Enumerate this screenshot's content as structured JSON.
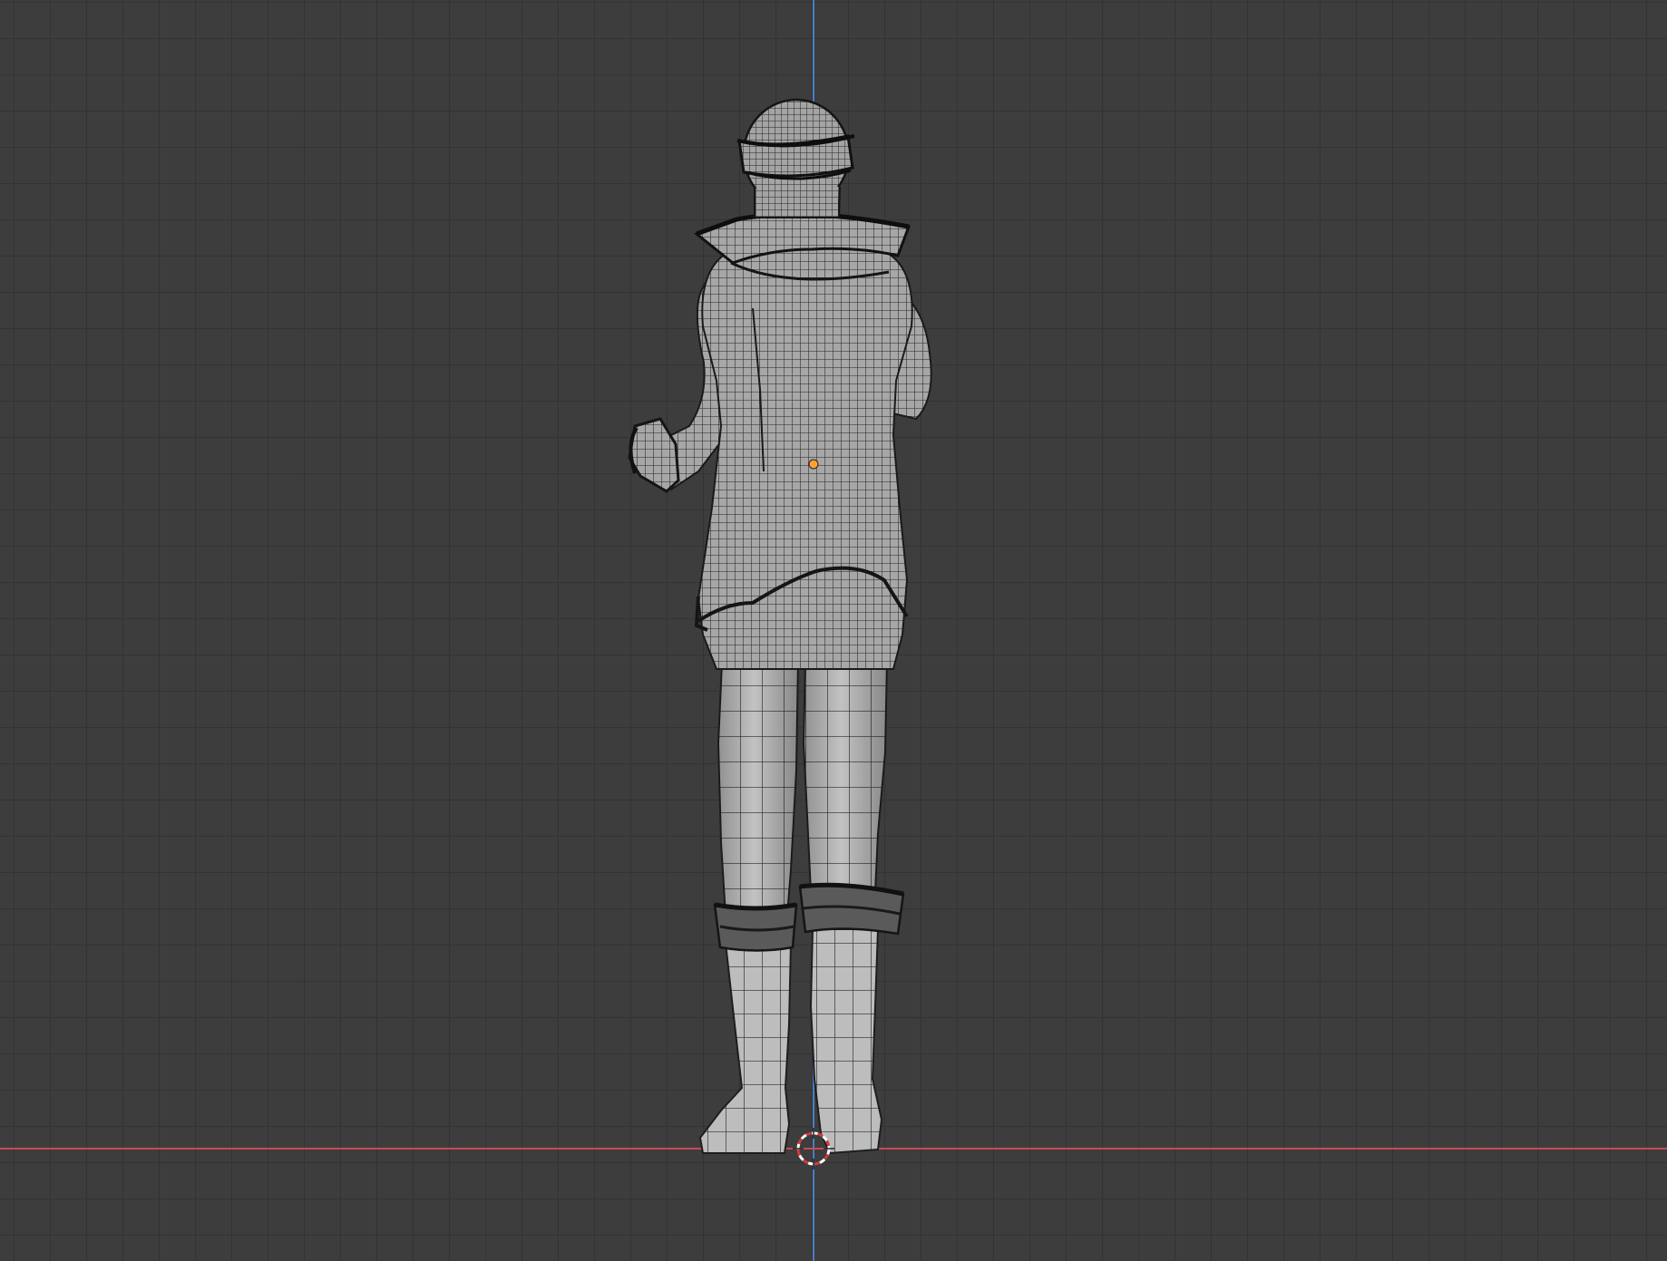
{
  "viewport": {
    "background_color": "#3d3d3d",
    "grid_line_color": "#333333",
    "x_axis_color": "#c84a55",
    "z_axis_color": "#4a7ec8",
    "origin_dot_color": "#ffa033"
  },
  "model": {
    "shading": "solid-wireframe",
    "base_color": "#a9a9a9",
    "edge_color": "#222222",
    "view": "back"
  }
}
